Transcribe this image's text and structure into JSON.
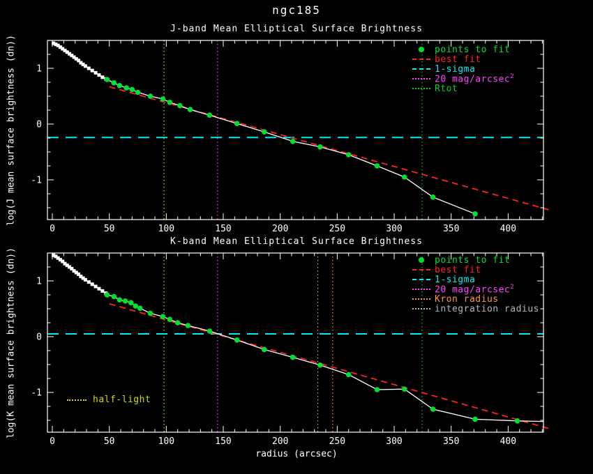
{
  "title": "ngc185",
  "xlabel": "radius (arcsec)",
  "colors": {
    "background": "#000000",
    "axis": "#ffffff",
    "points": "#00dd33",
    "best_fit": "#ff2222",
    "sigma": "#00eeee",
    "mag20": "#ff44ff",
    "rtot": "#00cc33",
    "kron": "#ff9933",
    "integration": "#b5b5b5",
    "half_light": "#d9d900"
  },
  "chart_data": [
    {
      "type": "line",
      "key": "j-band",
      "title": "J-band Mean Elliptical Surface Brightness",
      "ylabel": "log(J mean surface brightness (dn))",
      "xlim": [
        -4.3,
        431
      ],
      "ylim": [
        -1.7125,
        1.5
      ],
      "xticks": [
        0,
        50,
        100,
        150,
        200,
        250,
        300,
        350,
        400
      ],
      "yticks": [
        -1,
        0,
        1
      ],
      "x_minor_step": 10,
      "y_minor_step": 0.25,
      "one_sigma_y": -0.24,
      "best_fit": [
        [
          50,
          0.67
        ],
        [
          438,
          -1.55
        ]
      ],
      "vlines": [
        {
          "x": 98,
          "color": "half_light",
          "name": "half-light"
        },
        {
          "x": 145,
          "color": "mag20",
          "name": "20 mag/arcsec2"
        },
        {
          "x": 324.5,
          "color": "rtot",
          "name": "Rtot"
        }
      ],
      "points_not_fit": [
        [
          1,
          1.45
        ],
        [
          3,
          1.43
        ],
        [
          5,
          1.41
        ],
        [
          7,
          1.38
        ],
        [
          9,
          1.35
        ],
        [
          11,
          1.32
        ],
        [
          13,
          1.29
        ],
        [
          15,
          1.26
        ],
        [
          17,
          1.23
        ],
        [
          19,
          1.2
        ],
        [
          21,
          1.17
        ],
        [
          23,
          1.14
        ],
        [
          25,
          1.1
        ],
        [
          27,
          1.07
        ],
        [
          29,
          1.04
        ],
        [
          32,
          1.0
        ],
        [
          35,
          0.96
        ],
        [
          38,
          0.92
        ],
        [
          41,
          0.88
        ],
        [
          44,
          0.84
        ],
        [
          47,
          0.81
        ]
      ],
      "points_to_fit": [
        [
          48,
          0.8
        ],
        [
          54,
          0.74
        ],
        [
          59,
          0.69
        ],
        [
          65,
          0.65
        ],
        [
          70,
          0.62
        ],
        [
          75,
          0.57
        ],
        [
          86,
          0.5
        ],
        [
          97,
          0.45
        ],
        [
          103,
          0.39
        ],
        [
          112,
          0.33
        ],
        [
          121,
          0.26
        ],
        [
          138,
          0.16
        ],
        [
          162,
          0.01
        ],
        [
          186,
          -0.14
        ],
        [
          211,
          -0.31
        ],
        [
          235,
          -0.41
        ],
        [
          260,
          -0.55
        ],
        [
          285,
          -0.75
        ],
        [
          309,
          -0.95
        ],
        [
          334,
          -1.31
        ],
        [
          371,
          -1.61
        ]
      ],
      "curve_extension": [],
      "legend": [
        {
          "label": "points to fit",
          "color": "points",
          "marker": "dot"
        },
        {
          "label": "best fit",
          "color": "best_fit",
          "marker": "dash"
        },
        {
          "label": "1-sigma",
          "color": "sigma",
          "marker": "dash"
        },
        {
          "label": "20 mag/arcsec",
          "sup": "2",
          "color": "mag20",
          "marker": "dots"
        },
        {
          "label": "Rtot",
          "color": "rtot",
          "marker": "dots"
        }
      ]
    },
    {
      "type": "line",
      "key": "k-band",
      "title": "K-band Mean Elliptical Surface Brightness",
      "ylabel": "log(K mean surface brightness (dn))",
      "xlim": [
        -4.3,
        431
      ],
      "ylim": [
        -1.7125,
        1.5
      ],
      "xticks": [
        0,
        50,
        100,
        150,
        200,
        250,
        300,
        350,
        400
      ],
      "yticks": [
        -1,
        0,
        1
      ],
      "x_minor_step": 10,
      "y_minor_step": 0.25,
      "one_sigma_y": 0.05,
      "best_fit": [
        [
          50,
          0.59
        ],
        [
          438,
          -1.66
        ]
      ],
      "vlines": [
        {
          "x": 98,
          "color": "half_light",
          "name": "half-light"
        },
        {
          "x": 145,
          "color": "mag20",
          "name": "20 mag/arcsec2"
        },
        {
          "x": 233,
          "color": "integration",
          "name": "integration radius"
        },
        {
          "x": 246,
          "color": "kron",
          "name": "Kron radius"
        },
        {
          "x": 324.5,
          "color": "rtot",
          "name": "Rtot"
        }
      ],
      "points_not_fit": [
        [
          1,
          1.46
        ],
        [
          3,
          1.44
        ],
        [
          5,
          1.41
        ],
        [
          7,
          1.38
        ],
        [
          9,
          1.35
        ],
        [
          11,
          1.31
        ],
        [
          13,
          1.28
        ],
        [
          15,
          1.25
        ],
        [
          17,
          1.22
        ],
        [
          19,
          1.18
        ],
        [
          21,
          1.15
        ],
        [
          23,
          1.12
        ],
        [
          25,
          1.08
        ],
        [
          27,
          1.05
        ],
        [
          29,
          1.02
        ],
        [
          32,
          0.98
        ],
        [
          35,
          0.94
        ],
        [
          38,
          0.9
        ],
        [
          41,
          0.86
        ],
        [
          44,
          0.82
        ],
        [
          47,
          0.78
        ]
      ],
      "points_to_fit": [
        [
          48,
          0.75
        ],
        [
          54,
          0.72
        ],
        [
          59,
          0.66
        ],
        [
          64,
          0.64
        ],
        [
          69,
          0.61
        ],
        [
          73,
          0.55
        ],
        [
          77,
          0.51
        ],
        [
          86,
          0.42
        ],
        [
          97,
          0.36
        ],
        [
          103,
          0.31
        ],
        [
          110,
          0.25
        ],
        [
          119,
          0.2
        ],
        [
          138,
          0.1
        ],
        [
          162,
          -0.06
        ],
        [
          186,
          -0.23
        ],
        [
          211,
          -0.37
        ],
        [
          235,
          -0.51
        ],
        [
          260,
          -0.68
        ],
        [
          285,
          -0.95
        ],
        [
          309,
          -0.94
        ],
        [
          334,
          -1.3
        ],
        [
          371,
          -1.48
        ],
        [
          408,
          -1.51
        ]
      ],
      "curve_extension": [
        [
          431,
          -1.52
        ]
      ],
      "legend": [
        {
          "label": "points to fit",
          "color": "points",
          "marker": "dot"
        },
        {
          "label": "best fit",
          "color": "best_fit",
          "marker": "dash"
        },
        {
          "label": "1-sigma",
          "color": "sigma",
          "marker": "dash"
        },
        {
          "label": "20 mag/arcsec",
          "sup": "2",
          "color": "mag20",
          "marker": "dots"
        },
        {
          "label": "Kron radius",
          "color": "kron",
          "marker": "dots"
        },
        {
          "label": "integration radius",
          "color": "integration",
          "marker": "dots"
        }
      ],
      "annotation": {
        "label": "half-light",
        "color": "half_light"
      }
    }
  ]
}
